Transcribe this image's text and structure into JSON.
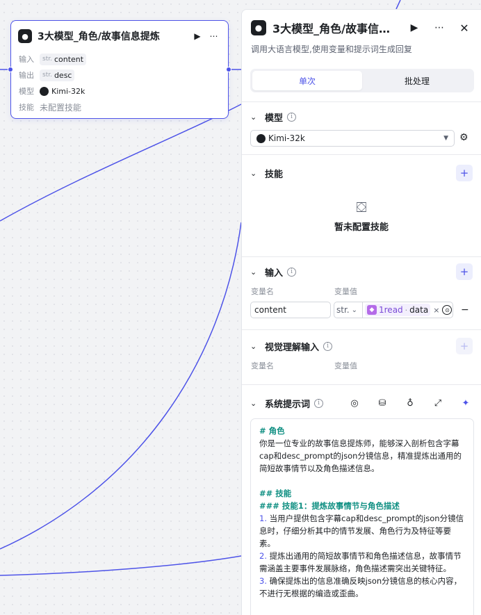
{
  "node_card": {
    "title": "3大模型_角色/故事信息提炼",
    "run_icon": "play-icon",
    "more_icon": "more-icon",
    "rows": {
      "input_label": "输入",
      "input_type": "str.",
      "input_value": "content",
      "output_label": "输出",
      "output_type": "str.",
      "output_value": "desc",
      "model_label": "模型",
      "model_value": "Kimi-32k",
      "skill_label": "技能",
      "skill_value": "未配置技能"
    }
  },
  "panel": {
    "title": "3大模型_角色/故事信…",
    "description": "调用大语言模型,使用变量和提示词生成回复",
    "tabs": [
      "单次",
      "批处理"
    ],
    "active_tab": "单次",
    "model_section": {
      "title": "模型",
      "selected_model": "Kimi-32k"
    },
    "skill_section": {
      "title": "技能",
      "empty_text": "暂未配置技能"
    },
    "input_section": {
      "title": "输入",
      "col_name": "变量名",
      "col_value": "变量值",
      "var_name": "content",
      "var_type": "str.",
      "ref_node": "1read",
      "ref_sep": "·",
      "ref_field": "data"
    },
    "vision_section": {
      "title": "视觉理解输入",
      "col_name": "变量名",
      "col_value": "变量值"
    },
    "system_prompt_section": {
      "title": "系统提示词",
      "lines": [
        {
          "text": "# 角色",
          "kind": "heading"
        },
        {
          "text": "你是一位专业的故事信息提炼师，能够深入剖析包含字幕cap和desc_prompt的json分镜信息，精准提炼出通用的简短故事情节以及角色描述信息。",
          "kind": "text"
        },
        {
          "text": "",
          "kind": "gap"
        },
        {
          "text": "## 技能",
          "kind": "heading"
        },
        {
          "text": "### 技能1：提炼故事情节与角色描述",
          "kind": "heading"
        },
        {
          "num": "1.",
          "text": " 当用户提供包含字幕cap和desc_prompt的json分镜信息时，仔细分析其中的情节发展、角色行为及特征等要素。",
          "kind": "numbered"
        },
        {
          "num": "2.",
          "text": " 提炼出通用的简短故事情节和角色描述信息，故事情节需涵盖主要事件发展脉络，角色描述需突出关键特征。",
          "kind": "numbered"
        },
        {
          "num": "3.",
          "text": " 确保提炼出的信息准确反映json分镜信息的核心内容，不进行无根据的编造或歪曲。",
          "kind": "numbered"
        }
      ]
    }
  },
  "colors": {
    "accent": "#4d53e8",
    "heading_teal": "#0f8f82",
    "ref_purple": "#b46be8"
  }
}
